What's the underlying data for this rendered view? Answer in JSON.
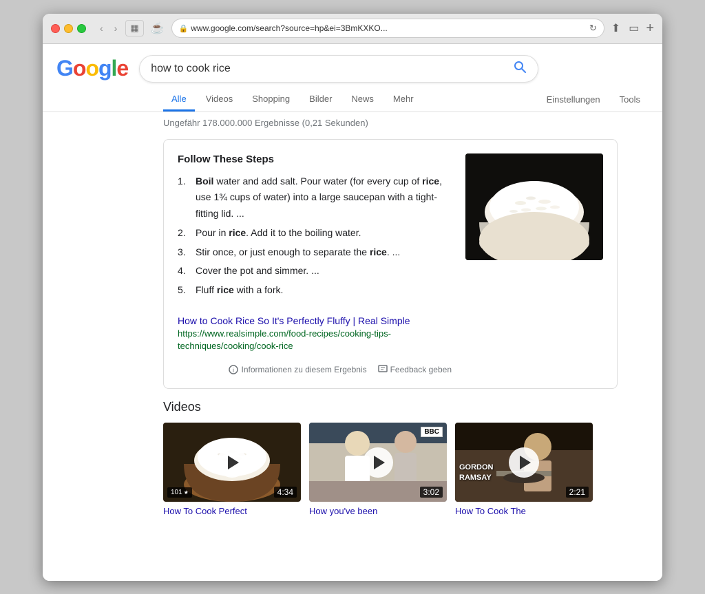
{
  "browser": {
    "address": "www.google.com/search?source=hp&ei=3BmKXKO...",
    "address_display": "🔒 www.google.com/search?source=hp&ei=3BmKXKO..."
  },
  "google": {
    "logo_letters": [
      "G",
      "o",
      "o",
      "g",
      "l",
      "e"
    ],
    "search_query": "how to cook rice",
    "search_placeholder": "how to cook rice"
  },
  "nav_tabs": [
    {
      "label": "Alle",
      "active": true
    },
    {
      "label": "Videos",
      "active": false
    },
    {
      "label": "Shopping",
      "active": false
    },
    {
      "label": "Bilder",
      "active": false
    },
    {
      "label": "News",
      "active": false
    },
    {
      "label": "Mehr",
      "active": false
    }
  ],
  "nav_right_tabs": [
    {
      "label": "Einstellungen"
    },
    {
      "label": "Tools"
    }
  ],
  "result_stats": "Ungefähr 178.000.000 Ergebnisse (0,21 Sekunden)",
  "featured_snippet": {
    "title": "Follow These Steps",
    "steps": [
      {
        "num": "1.",
        "text_parts": [
          {
            "bold": true,
            "text": "Boil"
          },
          {
            "bold": false,
            "text": " water and add salt. Pour water (for every cup of "
          },
          {
            "bold": true,
            "text": "rice"
          },
          {
            "bold": false,
            "text": ", use 1¾ cups of water) into a large saucepan with a tight-fitting lid. ..."
          }
        ]
      },
      {
        "num": "2.",
        "text_parts": [
          {
            "bold": false,
            "text": "Pour in "
          },
          {
            "bold": true,
            "text": "rice"
          },
          {
            "bold": false,
            "text": ". Add it to the boiling water."
          }
        ]
      },
      {
        "num": "3.",
        "text_parts": [
          {
            "bold": false,
            "text": "Stir once, or just enough to separate the "
          },
          {
            "bold": true,
            "text": "rice"
          },
          {
            "bold": false,
            "text": ". ..."
          }
        ]
      },
      {
        "num": "4.",
        "text_simple": "Cover the pot and simmer. ..."
      },
      {
        "num": "5.",
        "text_parts": [
          {
            "bold": false,
            "text": "Fluff "
          },
          {
            "bold": true,
            "text": "rice"
          },
          {
            "bold": false,
            "text": " with a fork."
          }
        ]
      }
    ],
    "link_title": "How to Cook Rice So It's Perfectly Fluffy | Real Simple",
    "link_url": "https://www.realsimple.com/food-recipes/cooking-tips-techniques/cooking/cook-rice",
    "footer_info": "Informationen zu diesem Ergebnis",
    "footer_feedback": "Feedback geben"
  },
  "videos_section": {
    "title": "Videos",
    "videos": [
      {
        "title": "How To Cook Perfect",
        "duration": "4:34",
        "badge": "101",
        "bg_class": "video-1-bg"
      },
      {
        "title": "How you've been",
        "duration": "3:02",
        "bbc": true,
        "bg_class": "video-2-bg"
      },
      {
        "title": "How To Cook The",
        "duration": "2:21",
        "gordon": true,
        "gordon_name": "GORDON\nRAMSAY",
        "bg_class": "video-3-bg"
      }
    ]
  }
}
